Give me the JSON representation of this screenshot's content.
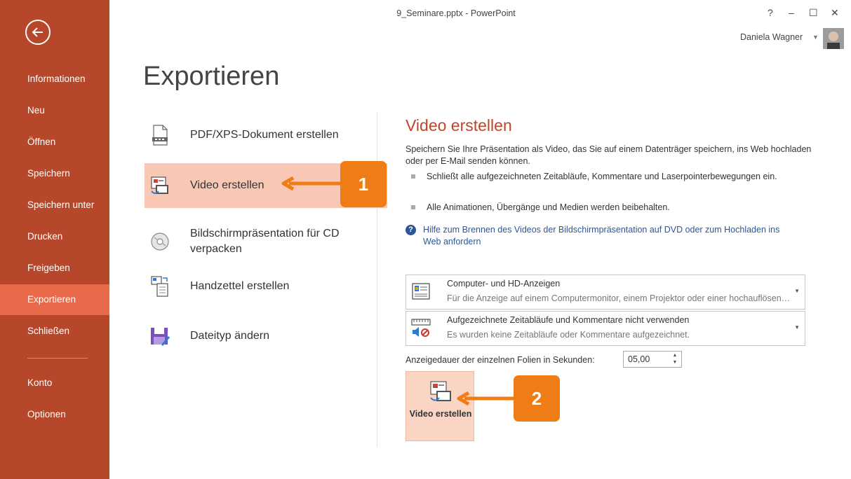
{
  "window": {
    "title": "9_Seminare.pptx - PowerPoint",
    "help_label": "?",
    "minimize_label": "–",
    "maximize_label": "☐",
    "close_label": "✕"
  },
  "user": {
    "name": "Daniela Wagner"
  },
  "sidebar": {
    "items": [
      {
        "label": "Informationen"
      },
      {
        "label": "Neu"
      },
      {
        "label": "Öffnen"
      },
      {
        "label": "Speichern"
      },
      {
        "label": "Speichern unter"
      },
      {
        "label": "Drucken"
      },
      {
        "label": "Freigeben"
      },
      {
        "label": "Exportieren"
      },
      {
        "label": "Schließen"
      },
      {
        "label": "Konto"
      },
      {
        "label": "Optionen"
      }
    ],
    "active_index": 7
  },
  "page": {
    "title": "Exportieren"
  },
  "options": [
    {
      "label": "PDF/XPS-Dokument erstellen",
      "icon": "pdf-document-icon"
    },
    {
      "label": "Video erstellen",
      "icon": "video-icon"
    },
    {
      "label": "Bildschirmpräsentation für CD verpacken",
      "icon": "cd-icon"
    },
    {
      "label": "Handzettel erstellen",
      "icon": "handout-icon"
    },
    {
      "label": "Dateityp ändern",
      "icon": "save-as-icon"
    }
  ],
  "panel": {
    "title": "Video erstellen",
    "description": "Speichern Sie Ihre Präsentation als Video, das Sie auf einem Datenträger speichern, ins Web hochladen oder per E-Mail senden können.",
    "bullets": [
      "Schließt alle aufgezeichneten Zeitabläufe, Kommentare und Laserpointerbewegungen ein.",
      "Alle Animationen, Übergänge und Medien werden beibehalten."
    ],
    "help_link": "Hilfe zum Brennen des Videos der Bildschirmpräsentation auf DVD oder zum Hochladen ins Web anfordern",
    "quality_dropdown": {
      "main": "Computer- und HD-Anzeigen",
      "sub": "Für die Anzeige auf einem Computermonitor, einem Projektor oder einer hochauflösenden Anzeige"
    },
    "timing_dropdown": {
      "main": "Aufgezeichnete Zeitabläufe und Kommentare nicht verwenden",
      "sub": "Es wurden keine Zeitabläufe oder Kommentare aufgezeichnet."
    },
    "duration_label": "Anzeigedauer der einzelnen Folien in Sekunden:",
    "duration_value": "05,00",
    "create_button_label": "Video erstellen"
  },
  "callouts": [
    {
      "label": "1"
    },
    {
      "label": "2"
    }
  ],
  "colors": {
    "sidebar": "#b7472a",
    "sidebar_active": "#e86a4a",
    "selected_option": "#f8c8b4",
    "accent_title": "#c0452a",
    "link": "#2b579a",
    "callout": "#f07c16"
  }
}
